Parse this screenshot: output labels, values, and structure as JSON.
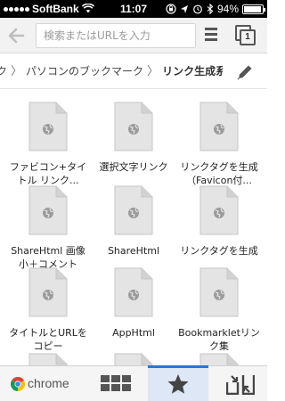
{
  "status_bar": {
    "carrier": "SoftBank",
    "time": "11:07",
    "battery_percent": "94%",
    "battery_level": 0.94
  },
  "toolbar": {
    "omnibox_placeholder": "検索またはURLを入力",
    "tab_count": "1"
  },
  "breadcrumb": {
    "items": [
      "ク",
      "パソコンのブックマーク"
    ],
    "current": "リンク生成系"
  },
  "bookmarks": [
    {
      "label": "ファビコン+タイトル リンク..."
    },
    {
      "label": "選択文字リンク"
    },
    {
      "label": "リンクタグを生成（Favicon付..."
    },
    {
      "label": "ShareHtml 画像小＋コメント"
    },
    {
      "label": "ShareHtml"
    },
    {
      "label": "リンクタグを生成"
    },
    {
      "label": "タイトルとURLをコピー"
    },
    {
      "label": "AppHtml"
    },
    {
      "label": "Bookmarkletリンク集"
    }
  ],
  "bottom_nav": {
    "brand": "chrome",
    "active": "bookmarks"
  },
  "colors": {
    "accent": "#2a76d2",
    "active_tab_bg": "#dde7f5",
    "icon_gray": "#9b9b9b"
  }
}
